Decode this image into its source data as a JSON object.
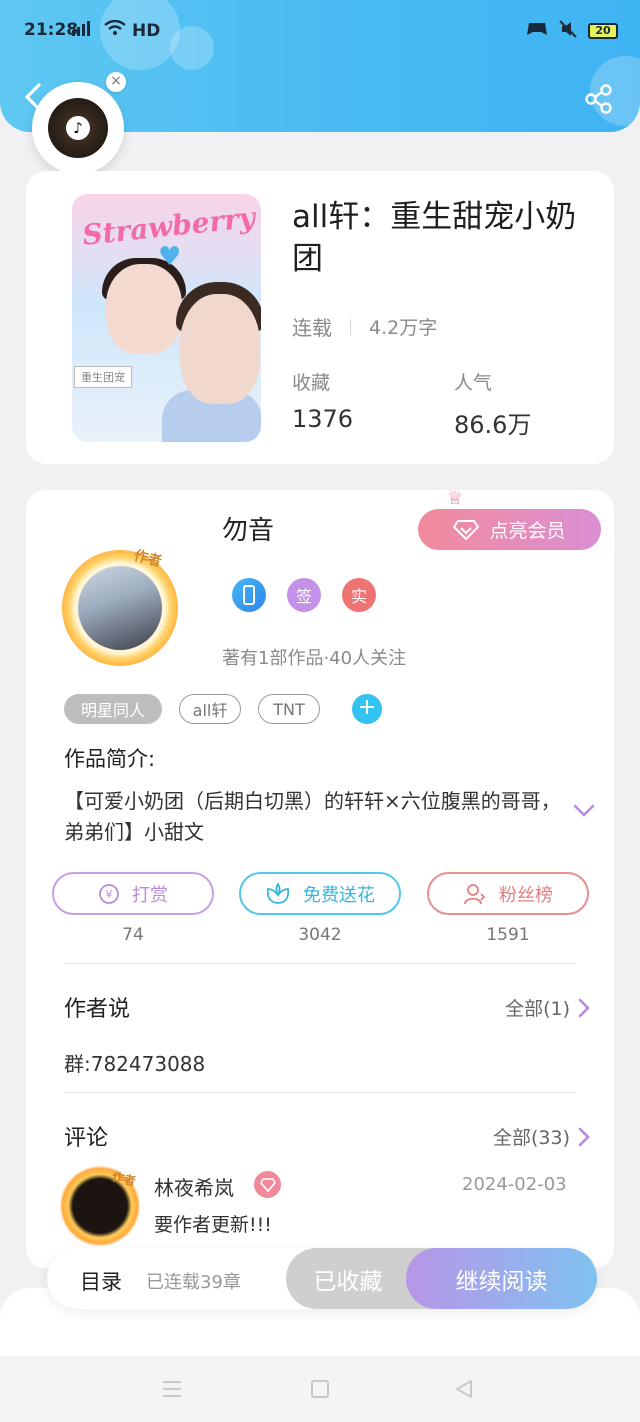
{
  "status_bar": {
    "time": "21:28",
    "network": "4G",
    "hd": "HD",
    "battery": "20"
  },
  "header": {
    "back_icon": "chevron-left-icon",
    "share_icon": "share-icon"
  },
  "music_widget": {
    "icon": "music-note-icon",
    "close": "×"
  },
  "book": {
    "cover_title": "Strawberry",
    "cover_subtitle": "重生团宠",
    "title": "all轩：重生甜宠小奶团",
    "status": "连载",
    "word_count": "4.2万字",
    "stats": [
      {
        "label": "收藏",
        "value": "1376"
      },
      {
        "label": "人气",
        "value": "86.6万"
      }
    ]
  },
  "author": {
    "avatar_tag": "作者",
    "name": "勿音",
    "vip_button": "点亮会员",
    "badges": [
      {
        "icon": "phone-icon",
        "text": "",
        "color": "#3aa0f0"
      },
      {
        "icon": "sign-icon",
        "text": "签",
        "color": "#c391e8"
      },
      {
        "icon": "verified-icon",
        "text": "实",
        "color": "#f07373"
      }
    ],
    "works_info": "著有1部作品·40人关注"
  },
  "tags": [
    "明星同人",
    "all轩",
    "TNT"
  ],
  "intro": {
    "label": "作品简介:",
    "text": "【可爱小奶团（后期白切黑）的轩轩×六位腹黑的哥哥，弟弟们】小甜文"
  },
  "actions": [
    {
      "label": "打赏",
      "icon": "yen-icon",
      "count": "74",
      "color": "#c7a0e6"
    },
    {
      "label": "免费送花",
      "icon": "flower-icon",
      "count": "3042",
      "color": "#52c7e6"
    },
    {
      "label": "粉丝榜",
      "icon": "fan-icon",
      "count": "1591",
      "color": "#ea8f8f"
    }
  ],
  "author_says": {
    "label": "作者说",
    "more": "全部(1)",
    "text": "群:782473088"
  },
  "comments": {
    "label": "评论",
    "more": "全部(33)",
    "items": [
      {
        "avatar_tag": "作者",
        "user": "林夜希岚",
        "date": "2024-02-03",
        "text": "要作者更新!!!"
      }
    ]
  },
  "bottom_bar": {
    "catalog": "目录",
    "chapters": "已连载39章",
    "collected": "已收藏",
    "continue": "继续阅读"
  },
  "nav": [
    "menu-icon",
    "home-icon",
    "back-icon"
  ]
}
